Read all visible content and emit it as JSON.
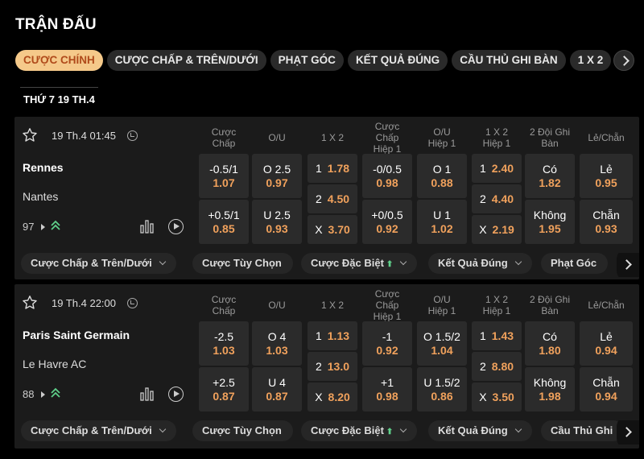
{
  "page": {
    "title": "TRẬN ĐẤU",
    "date": "THỨ 7 19 TH.4"
  },
  "tabs": [
    "CƯỢC CHÍNH",
    "CƯỢC CHẤP & TRÊN/DƯỚI",
    "PHẠT GÓC",
    "KẾT QUẢ ĐÚNG",
    "CẦU THỦ GHI BÀN",
    "1 X 2"
  ],
  "columns": [
    "Cược\nChấp",
    "O/U",
    "1 X 2",
    "Cược\nChấp\nHiệp 1",
    "O/U\nHiệp 1",
    "1 X 2\nHiệp 1",
    "2 Đội Ghi\nBàn",
    "Lẻ/Chẵn"
  ],
  "matches": [
    {
      "kickoff": "19 Th.4 01:45",
      "home": "Rennes",
      "away": "Nantes",
      "more_count": "97",
      "hdp": [
        {
          "label": "-0.5/1",
          "odd": "1.07"
        },
        {
          "label": "+0.5/1",
          "odd": "0.85"
        }
      ],
      "ou": [
        {
          "label": "O 2.5",
          "odd": "0.97"
        },
        {
          "label": "U 2.5",
          "odd": "0.93"
        }
      ],
      "x12": [
        {
          "label": "1",
          "odd": "1.78"
        },
        {
          "label": "2",
          "odd": "4.50"
        },
        {
          "label": "X",
          "odd": "3.70"
        }
      ],
      "hdp_h1": [
        {
          "label": "-0/0.5",
          "odd": "0.98"
        },
        {
          "label": "+0/0.5",
          "odd": "0.92"
        }
      ],
      "ou_h1": [
        {
          "label": "O 1",
          "odd": "0.88"
        },
        {
          "label": "U 1",
          "odd": "1.02"
        }
      ],
      "x12_h1": [
        {
          "label": "1",
          "odd": "2.40"
        },
        {
          "label": "2",
          "odd": "4.40"
        },
        {
          "label": "X",
          "odd": "2.19"
        }
      ],
      "btts": [
        {
          "label": "Có",
          "odd": "1.82"
        },
        {
          "label": "Không",
          "odd": "1.95"
        }
      ],
      "oe": [
        {
          "label": "Lẻ",
          "odd": "0.95"
        },
        {
          "label": "Chẵn",
          "odd": "0.93"
        }
      ],
      "subtabs": [
        "Cược Chấp & Trên/Dưới",
        "Cược Tùy Chọn",
        "Cược Đặc Biệt",
        "Kết Quả Đúng",
        "Phạt Góc"
      ]
    },
    {
      "kickoff": "19 Th.4 22:00",
      "home": "Paris Saint Germain",
      "away": "Le Havre AC",
      "more_count": "88",
      "hdp": [
        {
          "label": "-2.5",
          "odd": "1.03"
        },
        {
          "label": "+2.5",
          "odd": "0.87"
        }
      ],
      "ou": [
        {
          "label": "O 4",
          "odd": "1.03"
        },
        {
          "label": "U 4",
          "odd": "0.87"
        }
      ],
      "x12": [
        {
          "label": "1",
          "odd": "1.13"
        },
        {
          "label": "2",
          "odd": "13.0"
        },
        {
          "label": "X",
          "odd": "8.20"
        }
      ],
      "hdp_h1": [
        {
          "label": "-1",
          "odd": "0.92"
        },
        {
          "label": "+1",
          "odd": "0.98"
        }
      ],
      "ou_h1": [
        {
          "label": "O 1.5/2",
          "odd": "1.04"
        },
        {
          "label": "U 1.5/2",
          "odd": "0.86"
        }
      ],
      "x12_h1": [
        {
          "label": "1",
          "odd": "1.43"
        },
        {
          "label": "2",
          "odd": "8.80"
        },
        {
          "label": "X",
          "odd": "3.50"
        }
      ],
      "btts": [
        {
          "label": "Có",
          "odd": "1.80"
        },
        {
          "label": "Không",
          "odd": "1.98"
        }
      ],
      "oe": [
        {
          "label": "Lẻ",
          "odd": "0.94"
        },
        {
          "label": "Chẵn",
          "odd": "0.94"
        }
      ],
      "subtabs": [
        "Cược Chấp & Trên/Dưới",
        "Cược Tùy Chọn",
        "Cược Đặc Biệt",
        "Kết Quả Đúng",
        "Cầu Thủ Ghi"
      ]
    }
  ]
}
